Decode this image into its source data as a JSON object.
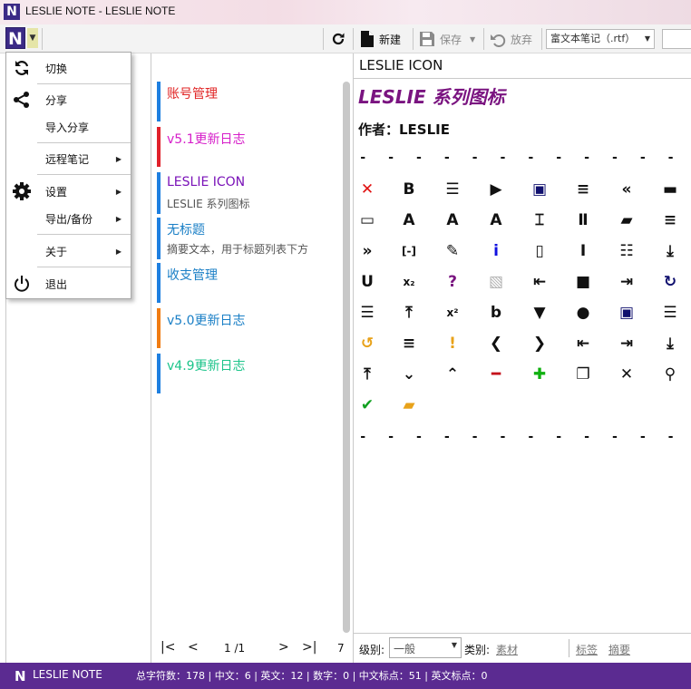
{
  "window": {
    "title": "LESLIE NOTE - LESLIE NOTE"
  },
  "toolbar": {
    "logo": "N",
    "new_label": "新建",
    "save_label": "保存",
    "discard_label": "放弃",
    "format_value": "富文本笔记（.rtf）"
  },
  "menu": {
    "switch": "切换",
    "share": "分享",
    "import_share": "导入分享",
    "remote_notes": "远程笔记",
    "settings": "设置",
    "export_backup": "导出/备份",
    "about": "关于",
    "exit": "退出"
  },
  "notes": [
    {
      "title": "账号管理",
      "subtitle": "",
      "color": "#e02424",
      "bar": "#1e7fe0"
    },
    {
      "title": "v5.1更新日志",
      "subtitle": "",
      "color": "#d61ec9",
      "bar": "#e0202a"
    },
    {
      "title": "LESLIE ICON",
      "subtitle": "LESLIE 系列图标",
      "color": "#7a12b8",
      "bar": "#1e7fe0"
    },
    {
      "title": "无标题",
      "subtitle": "摘要文本，用于标题列表下方",
      "color": "#1a7fc6",
      "bar": "#1e7fe0"
    },
    {
      "title": "收支管理",
      "subtitle": "",
      "color": "#1a7fc6",
      "bar": "#1e7fe0"
    },
    {
      "title": "v5.0更新日志",
      "subtitle": "",
      "color": "#1a7fc6",
      "bar": "#f07c12"
    },
    {
      "title": "v4.9更新日志",
      "subtitle": "",
      "color": "#1bc48a",
      "bar": "#1e7fe0"
    }
  ],
  "pager": {
    "page": "1 /1",
    "count": "7"
  },
  "editor": {
    "title": "LESLIE ICON",
    "heading": "LESLIE 系列图标",
    "author": "作者：LESLIE",
    "divider": "- - - - - - - - - - - - - - - - - - - - -"
  },
  "icons": [
    {
      "name": "close-icon",
      "glyph": "✕",
      "color": "#e01010"
    },
    {
      "name": "bold-icon",
      "glyph": "B",
      "color": "#111111"
    },
    {
      "name": "menu-icon",
      "glyph": "☰",
      "color": "#111111"
    },
    {
      "name": "play-icon",
      "glyph": "▶",
      "color": "#111111"
    },
    {
      "name": "save-icon",
      "glyph": "▣",
      "color": "#10106e"
    },
    {
      "name": "align-left-icon",
      "glyph": "≡",
      "color": "#111111"
    },
    {
      "name": "double-left-icon",
      "glyph": "«",
      "color": "#111111"
    },
    {
      "name": "minimize-icon",
      "glyph": "▬",
      "color": "#111111"
    },
    {
      "name": "window-icon",
      "glyph": "▭",
      "color": "#111111"
    },
    {
      "name": "font-color-icon",
      "glyph": "A",
      "color": "#111111"
    },
    {
      "name": "font-bg-icon",
      "glyph": "A",
      "color": "#111111"
    },
    {
      "name": "font-icon",
      "glyph": "A",
      "color": "#111111"
    },
    {
      "name": "textbox-icon",
      "glyph": "⌶",
      "color": "#111111"
    },
    {
      "name": "pause-icon",
      "glyph": "Ⅱ",
      "color": "#111111"
    },
    {
      "name": "terminal-icon",
      "glyph": "▰",
      "color": "#111111"
    },
    {
      "name": "align-right-icon",
      "glyph": "≡",
      "color": "#111111"
    },
    {
      "name": "double-right-icon",
      "glyph": "»",
      "color": "#111111"
    },
    {
      "name": "bracket-icon",
      "glyph": "[-]",
      "color": "#111111"
    },
    {
      "name": "edit-icon",
      "glyph": "✎",
      "color": "#111111"
    },
    {
      "name": "info-icon",
      "glyph": "i",
      "color": "#1010e0"
    },
    {
      "name": "page-icon",
      "glyph": "▯",
      "color": "#111111"
    },
    {
      "name": "italic-icon",
      "glyph": "I",
      "color": "#111111"
    },
    {
      "name": "list-icon",
      "glyph": "☷",
      "color": "#111111"
    },
    {
      "name": "download-icon",
      "glyph": "⤓",
      "color": "#111111"
    },
    {
      "name": "underline-icon",
      "glyph": "U",
      "color": "#111111"
    },
    {
      "name": "subscript-icon",
      "glyph": "x₂",
      "color": "#111111"
    },
    {
      "name": "help-icon",
      "glyph": "?",
      "color": "#7a1480"
    },
    {
      "name": "image-icon",
      "glyph": "▧",
      "color": "#b0b0b0"
    },
    {
      "name": "outdent-icon",
      "glyph": "⇤",
      "color": "#111111"
    },
    {
      "name": "stop-icon",
      "glyph": "■",
      "color": "#111111"
    },
    {
      "name": "indent-icon",
      "glyph": "⇥",
      "color": "#111111"
    },
    {
      "name": "refresh-icon",
      "glyph": "↻",
      "color": "#10106e"
    },
    {
      "name": "sliders-icon",
      "glyph": "☰",
      "color": "#111111"
    },
    {
      "name": "upload-icon",
      "glyph": "⤒",
      "color": "#111111"
    },
    {
      "name": "superscript-icon",
      "glyph": "x²",
      "color": "#111111"
    },
    {
      "name": "strikethrough-icon",
      "glyph": "b",
      "color": "#111111"
    },
    {
      "name": "filter-icon",
      "glyph": "▼",
      "color": "#111111"
    },
    {
      "name": "circle-icon",
      "glyph": "●",
      "color": "#111111"
    },
    {
      "name": "save-as-icon",
      "glyph": "▣",
      "color": "#10106e"
    },
    {
      "name": "align-justify-icon",
      "glyph": "☰",
      "color": "#111111"
    },
    {
      "name": "undo-icon",
      "glyph": "↺",
      "color": "#e8a21a"
    },
    {
      "name": "align-center-icon",
      "glyph": "≡",
      "color": "#111111"
    },
    {
      "name": "warning-icon",
      "glyph": "!",
      "color": "#e8a21a"
    },
    {
      "name": "chevron-left-icon",
      "glyph": "❮",
      "color": "#111111"
    },
    {
      "name": "chevron-right-icon",
      "glyph": "❯",
      "color": "#111111"
    },
    {
      "name": "first-icon",
      "glyph": "⇤",
      "color": "#111111"
    },
    {
      "name": "last-icon",
      "glyph": "⇥",
      "color": "#111111"
    },
    {
      "name": "arrow-down-bar-icon",
      "glyph": "⤓",
      "color": "#111111"
    },
    {
      "name": "arrow-up-bar-icon",
      "glyph": "⤒",
      "color": "#111111"
    },
    {
      "name": "chevron-down-icon",
      "glyph": "⌄",
      "color": "#111111"
    },
    {
      "name": "chevron-up-icon",
      "glyph": "⌃",
      "color": "#111111"
    },
    {
      "name": "minus-icon",
      "glyph": "━",
      "color": "#c4101a"
    },
    {
      "name": "plus-icon",
      "glyph": "✚",
      "color": "#10b010"
    },
    {
      "name": "restore-icon",
      "glyph": "❐",
      "color": "#111111"
    },
    {
      "name": "x-icon",
      "glyph": "✕",
      "color": "#111111"
    },
    {
      "name": "search-icon",
      "glyph": "⚲",
      "color": "#111111"
    },
    {
      "name": "check-icon",
      "glyph": "✔",
      "color": "#10a020"
    },
    {
      "name": "folder-icon",
      "glyph": "▰",
      "color": "#e8a21a"
    }
  ],
  "fields": {
    "level_label": "级别:",
    "level_value": "一般",
    "category_label": "类别:",
    "category_value": "素材",
    "tags_link": "标签",
    "summary_link": "摘要"
  },
  "status": {
    "app_name": "LESLIE NOTE",
    "stats": "总字符数：178 | 中文：6 | 英文：12 | 数字：0 | 中文标点：51 | 英文标点：0"
  },
  "colors": {
    "status_bg": "#5b2b91",
    "heading": "#7a1480",
    "brand": "#3b2a86"
  }
}
